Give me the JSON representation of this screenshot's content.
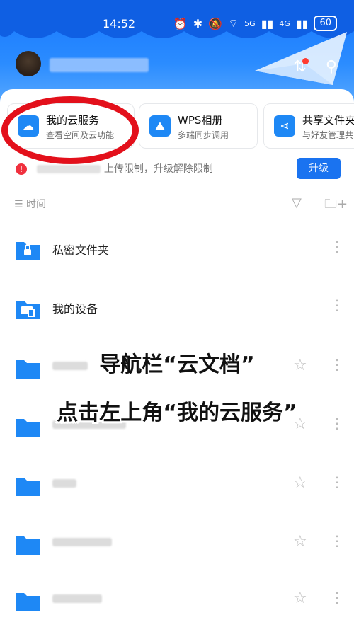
{
  "status": {
    "time": "14:52",
    "battery": "60",
    "net1": "5G",
    "net2": "4G"
  },
  "cards": [
    {
      "title": "我的云服务",
      "subtitle": "查看空间及云功能"
    },
    {
      "title": "WPS相册",
      "subtitle": "多端同步调用"
    },
    {
      "title": "共享文件夹",
      "subtitle": "与好友管理共"
    }
  ],
  "banner": {
    "text": "上传限制，升级解除限制",
    "button": "升级"
  },
  "sort": {
    "label": "时间"
  },
  "files": [
    {
      "name": "私密文件夹"
    },
    {
      "name": "我的设备"
    }
  ],
  "overlay": {
    "line1": "导航栏“云文档”",
    "line2": "点击左上角“我的云服务”"
  },
  "colors": {
    "accent": "#1a73f0",
    "folder": "#1e88f5",
    "annotation": "#e3101b"
  }
}
